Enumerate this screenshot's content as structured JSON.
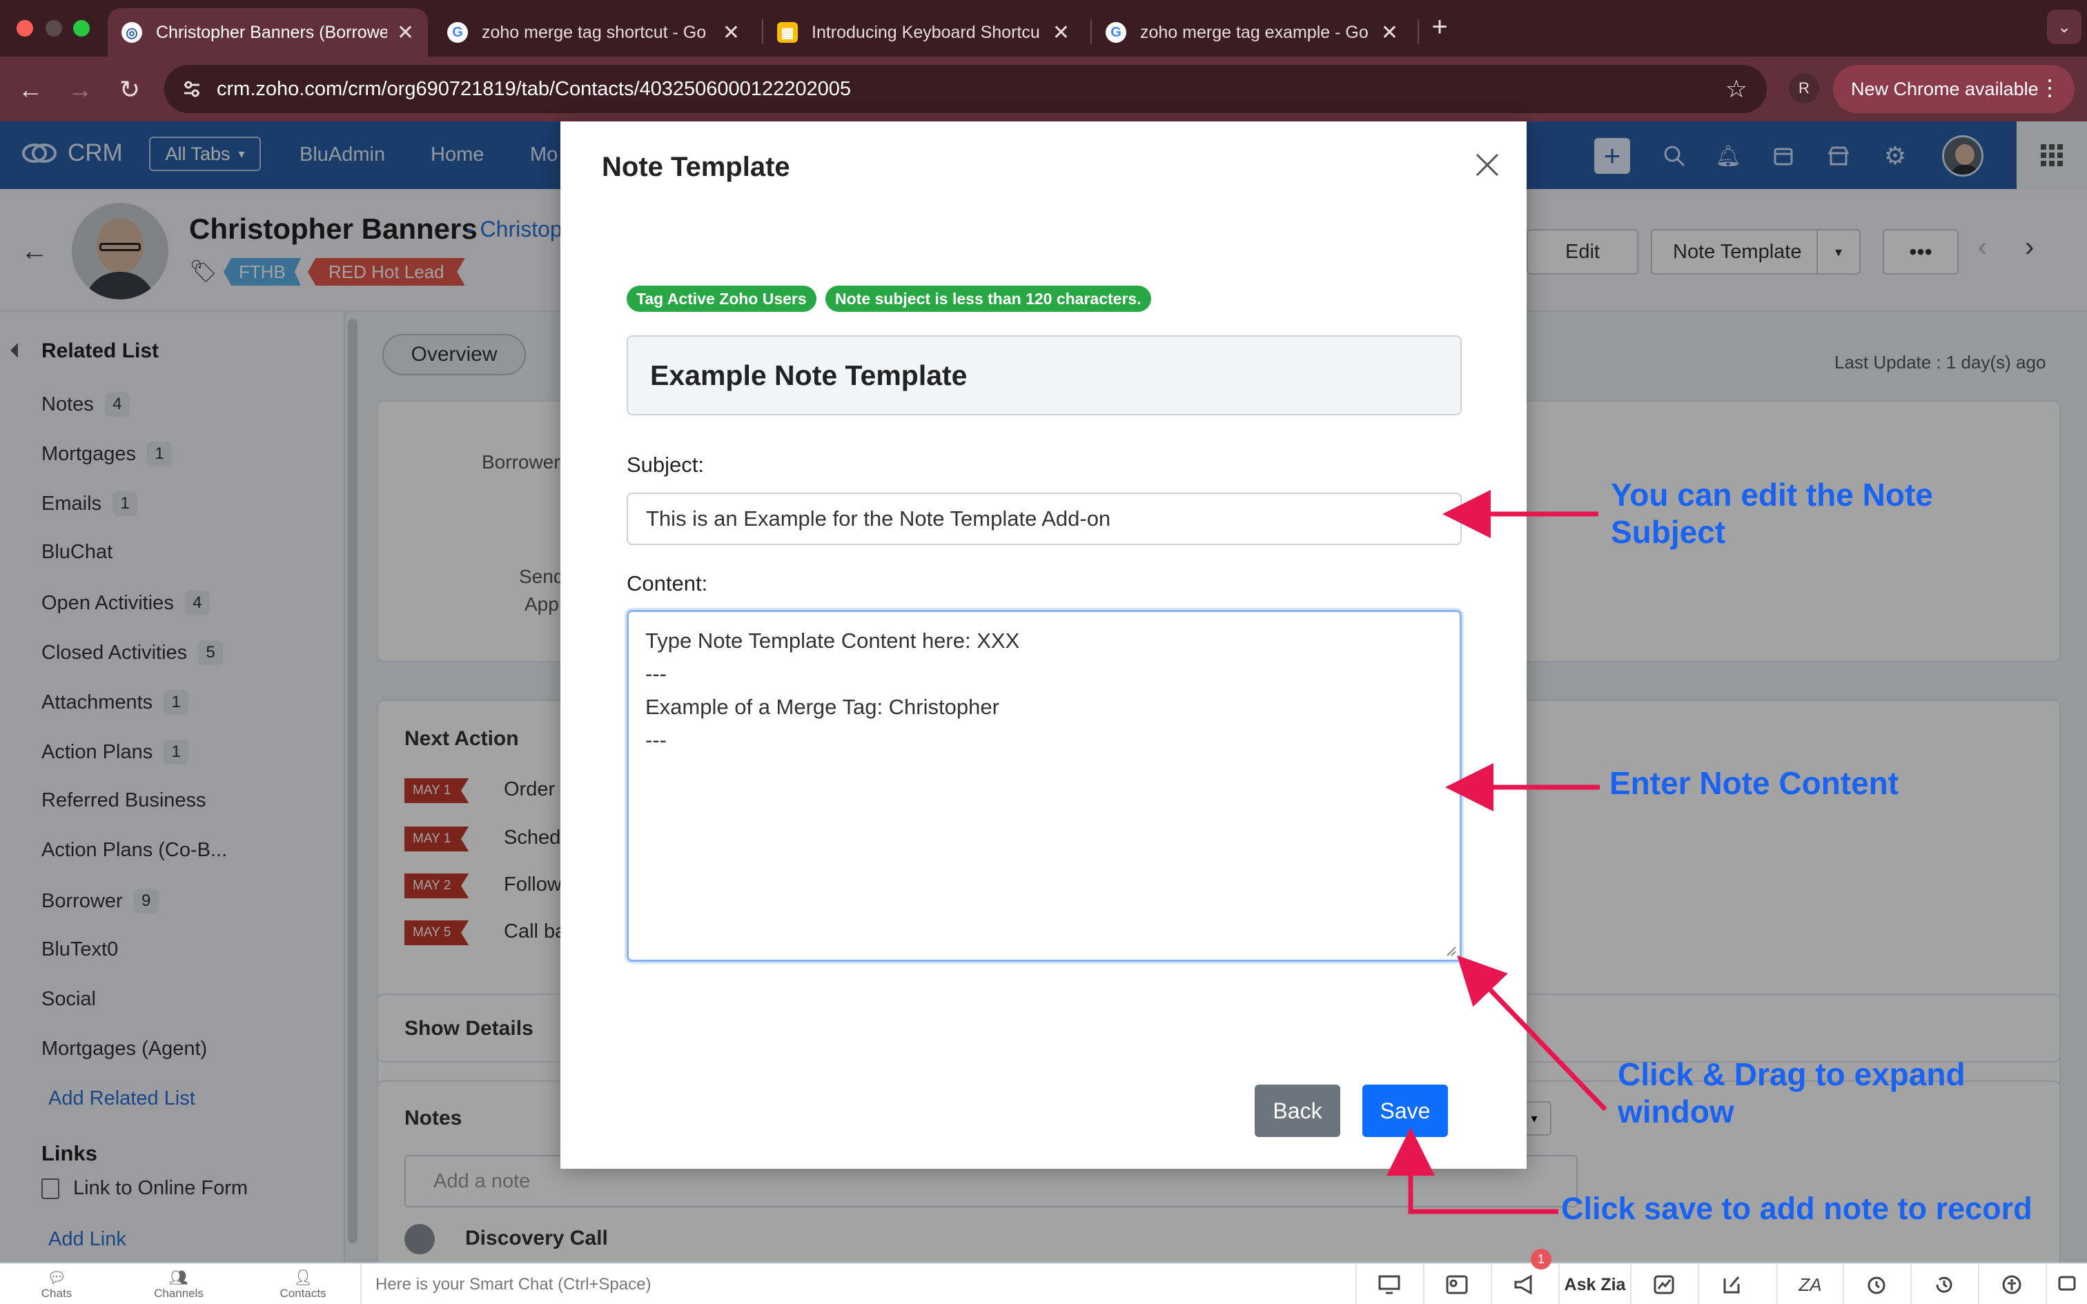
{
  "browser": {
    "tabs": [
      {
        "title": "Christopher Banners (Borrower",
        "active": true
      },
      {
        "title": "zoho merge tag shortcut - Go",
        "active": false
      },
      {
        "title": "Introducing Keyboard Shortcu",
        "active": false
      },
      {
        "title": "zoho merge tag example - Go",
        "active": false
      }
    ],
    "url": "crm.zoho.com/crm/org690721819/tab/Contacts/4032506000122202005",
    "profile_initial": "R",
    "update_button": "New Chrome available"
  },
  "crm": {
    "logo_text": "CRM",
    "all_tabs": "All Tabs",
    "nav": [
      "BluAdmin",
      "Home",
      "Mo"
    ],
    "record": {
      "name": "Christopher Banners",
      "name_suffix": "- Christop",
      "tags": [
        "FTHB",
        "RED Hot Lead"
      ],
      "edit_button": "Edit",
      "template_button": "Note Template",
      "last_update": "Last Update : 1 day(s) ago",
      "overview_tab": "Overview"
    },
    "sidebar": {
      "title": "Related List",
      "items": [
        {
          "label": "Notes",
          "count": "4"
        },
        {
          "label": "Mortgages",
          "count": "1"
        },
        {
          "label": "Emails",
          "count": "1"
        },
        {
          "label": "BluChat",
          "count": ""
        },
        {
          "label": "Open Activities",
          "count": "4"
        },
        {
          "label": "Closed Activities",
          "count": "5"
        },
        {
          "label": "Attachments",
          "count": "1"
        },
        {
          "label": "Action Plans",
          "count": "1"
        },
        {
          "label": "Referred Business",
          "count": ""
        },
        {
          "label": "Action Plans (Co-B...",
          "count": ""
        },
        {
          "label": "Borrower",
          "count": "9"
        },
        {
          "label": "BluText0",
          "count": ""
        },
        {
          "label": "Social",
          "count": ""
        },
        {
          "label": "Mortgages (Agent)",
          "count": ""
        }
      ],
      "add_related": "Add Related List",
      "links_title": "Links",
      "link_item": "Link to Online Form",
      "add_link": "Add Link"
    },
    "main": {
      "borrower_label": "Borrower",
      "send_label": "Send",
      "app_label": "App",
      "next_action_title": "Next Action",
      "next_actions": [
        {
          "date": "MAY 1",
          "text": "Order"
        },
        {
          "date": "MAY 1",
          "text": "Sched"
        },
        {
          "date": "MAY 2",
          "text": "Follow"
        },
        {
          "date": "MAY 5",
          "text": "Call ba"
        }
      ],
      "show_details": "Show Details",
      "notes_title": "Notes",
      "add_note_placeholder": "Add a note",
      "discovery_call": "Discovery Call"
    },
    "bottom_bar": {
      "items": [
        "Chats",
        "Channels",
        "Contacts"
      ],
      "smart_chat": "Here is your Smart Chat (Ctrl+Space)",
      "ask_zia": "Ask Zia",
      "notification_count": "1"
    }
  },
  "modal": {
    "title": "Note Template",
    "badges": [
      "Tag Active Zoho Users",
      "Note subject is less than 120 characters."
    ],
    "template_name": "Example Note Template",
    "subject_label": "Subject:",
    "subject_value": "This is an Example for the Note Template Add-on",
    "content_label": "Content:",
    "content_lines": [
      "Type Note Template Content here: XXX",
      "---",
      "Example of a Merge Tag: Christopher",
      "---"
    ],
    "back_button": "Back",
    "save_button": "Save"
  },
  "annotations": {
    "subject_note": [
      "You can edit the Note",
      "Subject"
    ],
    "content_note": "Enter Note Content",
    "resize_note": [
      "Click & Drag to expand",
      "window"
    ],
    "save_note": "Click save to add note to record",
    "color": "#1a63f2",
    "arrow_color": "#e8164f"
  }
}
